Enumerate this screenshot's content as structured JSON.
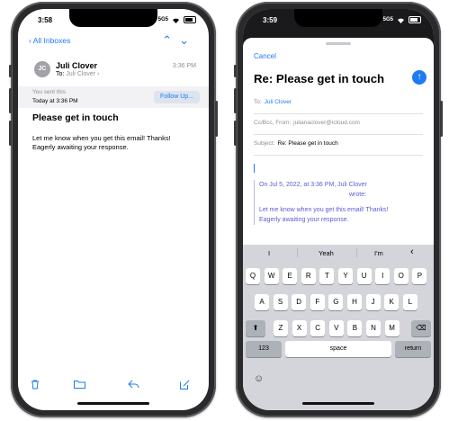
{
  "left_phone": {
    "status": {
      "time": "3:58",
      "carrier": "5G5"
    },
    "nav": {
      "back_label": "All Inboxes"
    },
    "message": {
      "avatar_initials": "JC",
      "sender": "Juli Clover",
      "to_prefix": "To:",
      "to_name": "Juli Clover",
      "time": "3:36 PM",
      "sent_note_line1": "You sent this",
      "sent_note_line2": "Today at 3:36 PM",
      "follow_up_label": "Follow Up...",
      "subject": "Please get in touch",
      "body_line1": "Let me know when you get this email! Thanks!",
      "body_line2": "Eagerly awaiting your response."
    }
  },
  "right_phone": {
    "status": {
      "time": "3:59",
      "carrier": "5G5"
    },
    "compose": {
      "cancel_label": "Cancel",
      "subject_title": "Re: Please get in touch",
      "to_label": "To:",
      "to_value": "Juli Clover",
      "cc_label": "Cc/Bcc, From:",
      "cc_value": "julianaclover@icloud.com",
      "subject_label": "Subject:",
      "subject_value": "Re: Please get in touch",
      "quote_line1": "On Jul 5, 2022, at 3:36 PM, Juli Clover",
      "quote_line2": "wrote:",
      "quote_body1": "Let me know when you get this email! Thanks!",
      "quote_body2": "Eagerly awaiting your response."
    },
    "keyboard": {
      "suggestions": [
        "I",
        "Yeah",
        "I'm"
      ],
      "row1": [
        "Q",
        "W",
        "E",
        "R",
        "T",
        "Y",
        "U",
        "I",
        "O",
        "P"
      ],
      "row2": [
        "A",
        "S",
        "D",
        "F",
        "G",
        "H",
        "J",
        "K",
        "L"
      ],
      "row3": [
        "Z",
        "X",
        "C",
        "V",
        "B",
        "N",
        "M"
      ],
      "numbers_label": "123",
      "space_label": "space",
      "return_label": "return"
    }
  },
  "colors": {
    "accent": "#1e7bf2",
    "quote": "#5d5bd4"
  }
}
